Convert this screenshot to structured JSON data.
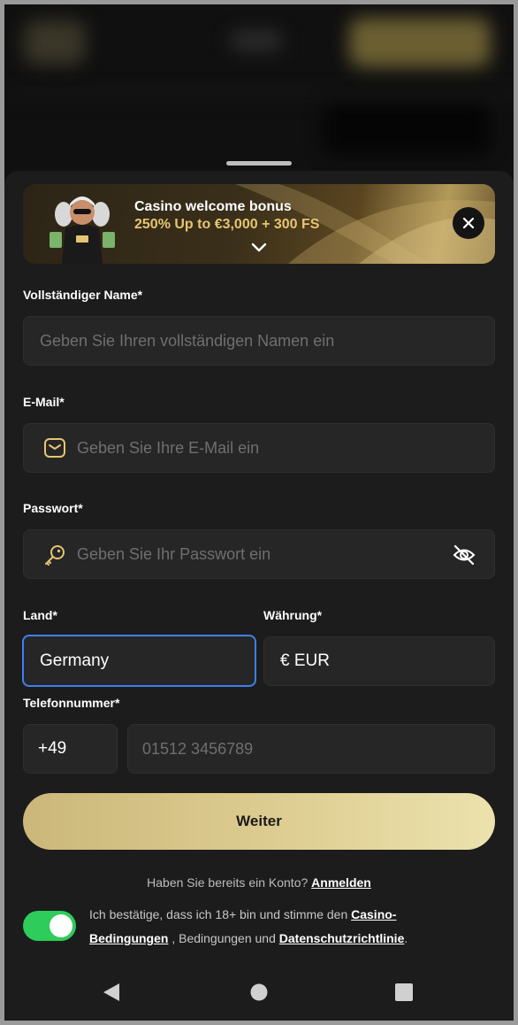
{
  "banner": {
    "title": "Casino welcome bonus",
    "subtitle": "250% Up to €3,000 + 300 FS"
  },
  "form": {
    "full_name": {
      "label": "Vollständiger Name*",
      "placeholder": "Geben Sie Ihren vollständigen Namen ein"
    },
    "email": {
      "label": "E-Mail*",
      "placeholder": "Geben Sie Ihre E-Mail ein"
    },
    "password": {
      "label": "Passwort*",
      "placeholder": "Geben Sie Ihr Passwort ein"
    },
    "country": {
      "label": "Land*",
      "value": "Germany"
    },
    "currency": {
      "label": "Währung*",
      "value": "€ EUR"
    },
    "phone": {
      "label": "Telefonnummer*",
      "code": "+49",
      "placeholder": "01512 3456789"
    },
    "submit_label": "Weiter"
  },
  "login": {
    "question": "Haben Sie bereits ein Konto?",
    "link": "Anmelden"
  },
  "consent": {
    "text1": "Ich bestätige, dass ich 18+ bin und stimme den ",
    "link1": "Casino-Bedingungen",
    "text2": " , Bedingungen und ",
    "link2": "Datenschutzrichtlinie",
    "text3": ".",
    "checked": true
  },
  "icons": {
    "close": "close-icon",
    "chevron": "chevron-down-icon",
    "email": "envelope-icon",
    "password": "key-icon",
    "visibility": "eye-off-icon",
    "nav": [
      "back-triangle-icon",
      "home-circle-icon",
      "recents-square-icon"
    ]
  },
  "colors": {
    "accent_gold": "#e6c572",
    "cta_gradient_start": "#cbb77a",
    "cta_gradient_end": "#ece2ad",
    "focus_border": "#3f7ff0",
    "toggle_on": "#2ecc5a",
    "background": "#1c1c1c"
  }
}
